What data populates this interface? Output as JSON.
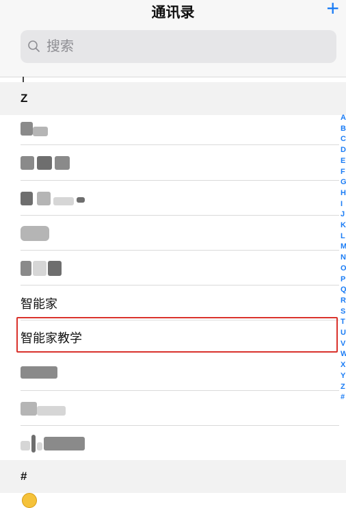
{
  "header": {
    "title": "通讯录",
    "add_label": "+"
  },
  "search": {
    "placeholder": "搜索"
  },
  "sections": {
    "z_label": "Z",
    "hash_label": "#"
  },
  "contacts": {
    "zhinengjia": "智能家",
    "zhinengjia_jiaoxue": "智能家教学"
  },
  "index_letters": [
    "A",
    "B",
    "C",
    "D",
    "E",
    "F",
    "G",
    "H",
    "I",
    "J",
    "K",
    "L",
    "M",
    "N",
    "O",
    "P",
    "Q",
    "R",
    "S",
    "T",
    "U",
    "V",
    "W",
    "X",
    "Y",
    "Z",
    "#"
  ],
  "colors": {
    "accent": "#1a7cf5",
    "highlight_border": "#d9312b"
  }
}
